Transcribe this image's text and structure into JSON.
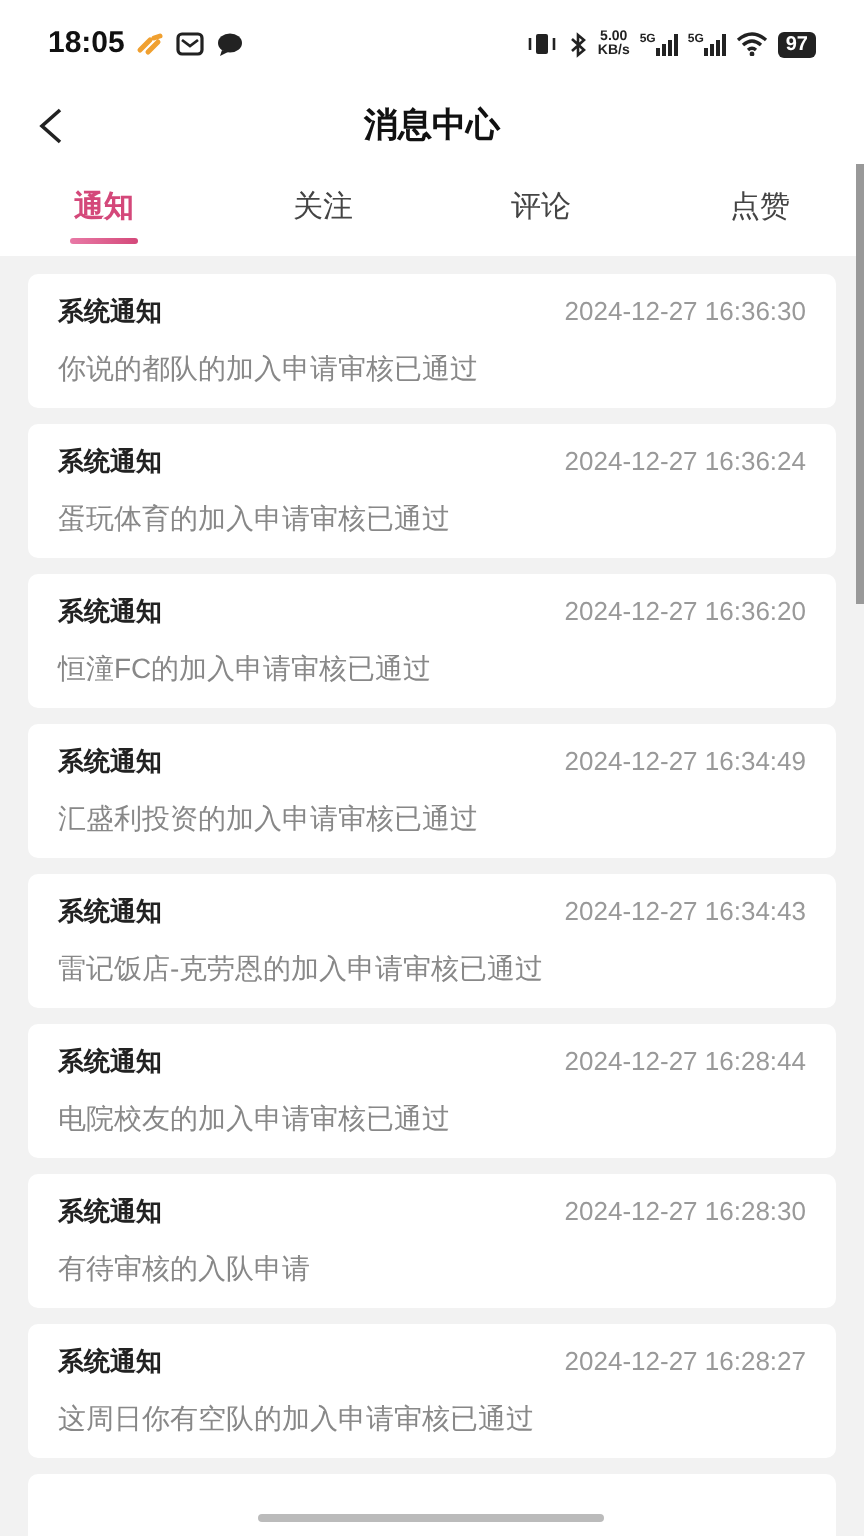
{
  "status_bar": {
    "time": "18:05",
    "net_speed": "5.00",
    "net_unit": "KB/s",
    "sim1": "5G",
    "sim2": "5G",
    "battery": "97"
  },
  "header": {
    "title": "消息中心"
  },
  "tabs": [
    {
      "label": "通知",
      "selected": true
    },
    {
      "label": "关注",
      "selected": false
    },
    {
      "label": "评论",
      "selected": false
    },
    {
      "label": "点赞",
      "selected": false
    }
  ],
  "notifications": [
    {
      "title": "系统通知",
      "time": "2024-12-27 16:36:30",
      "body": "你说的都队的加入申请审核已通过"
    },
    {
      "title": "系统通知",
      "time": "2024-12-27 16:36:24",
      "body": "蛋玩体育的加入申请审核已通过"
    },
    {
      "title": "系统通知",
      "time": "2024-12-27 16:36:20",
      "body": "恒潼FC的加入申请审核已通过"
    },
    {
      "title": "系统通知",
      "time": "2024-12-27 16:34:49",
      "body": "汇盛利投资的加入申请审核已通过"
    },
    {
      "title": "系统通知",
      "time": "2024-12-27 16:34:43",
      "body": "雷记饭店-克劳恩的加入申请审核已通过"
    },
    {
      "title": "系统通知",
      "time": "2024-12-27 16:28:44",
      "body": "电院校友的加入申请审核已通过"
    },
    {
      "title": "系统通知",
      "time": "2024-12-27 16:28:30",
      "body": "有待审核的入队申请"
    },
    {
      "title": "系统通知",
      "time": "2024-12-27 16:28:27",
      "body": "这周日你有空队的加入申请审核已通过"
    }
  ]
}
